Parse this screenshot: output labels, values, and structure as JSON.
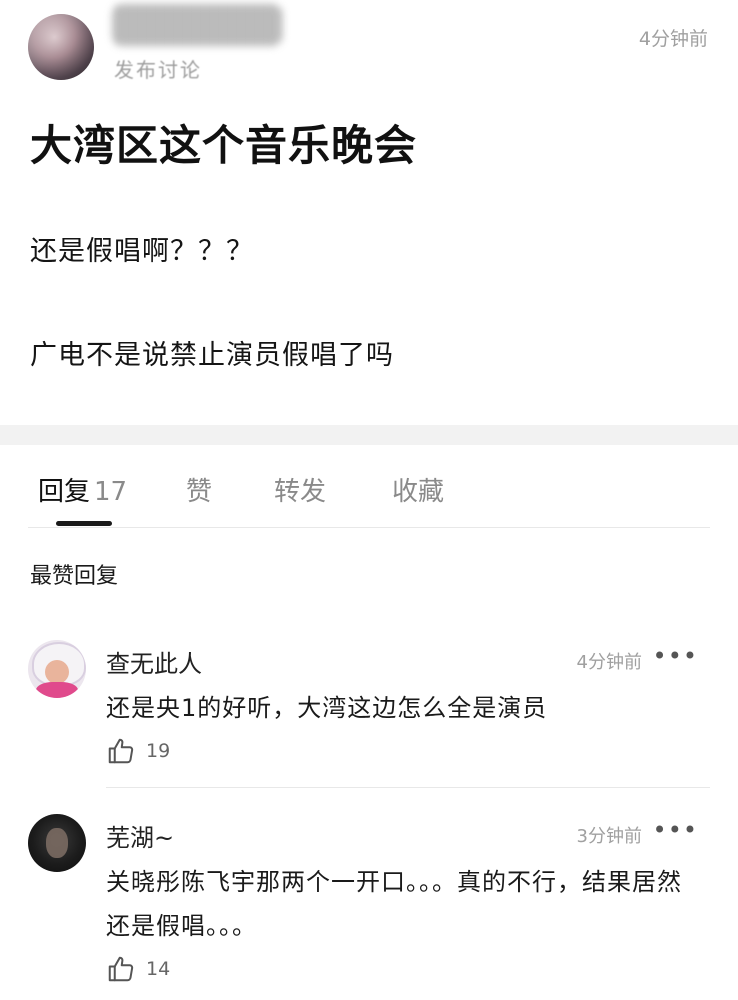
{
  "post": {
    "action": "发布讨论",
    "time": "4分钟前",
    "title": "大湾区这个音乐晚会",
    "lines": [
      "还是假唱啊？？？",
      "广电不是说禁止演员假唱了吗"
    ]
  },
  "tabs": [
    {
      "label": "回复",
      "count": "17",
      "active": true
    },
    {
      "label": "赞"
    },
    {
      "label": "转发"
    },
    {
      "label": "收藏"
    }
  ],
  "section_title": "最赞回复",
  "comments": [
    {
      "name": "查无此人",
      "time": "4分钟前",
      "more": "•••",
      "text": "还是央1的好听，大湾这边怎么全是演员",
      "likes": "19",
      "like_icon": "thumbs-up-icon"
    },
    {
      "name": "芜湖~",
      "time": "3分钟前",
      "more": "•••",
      "text": "关晓彤陈飞宇那两个一开口。。。真的不行，结果居然还是假唱。。。",
      "likes": "14",
      "like_icon": "thumbs-up-icon"
    }
  ]
}
